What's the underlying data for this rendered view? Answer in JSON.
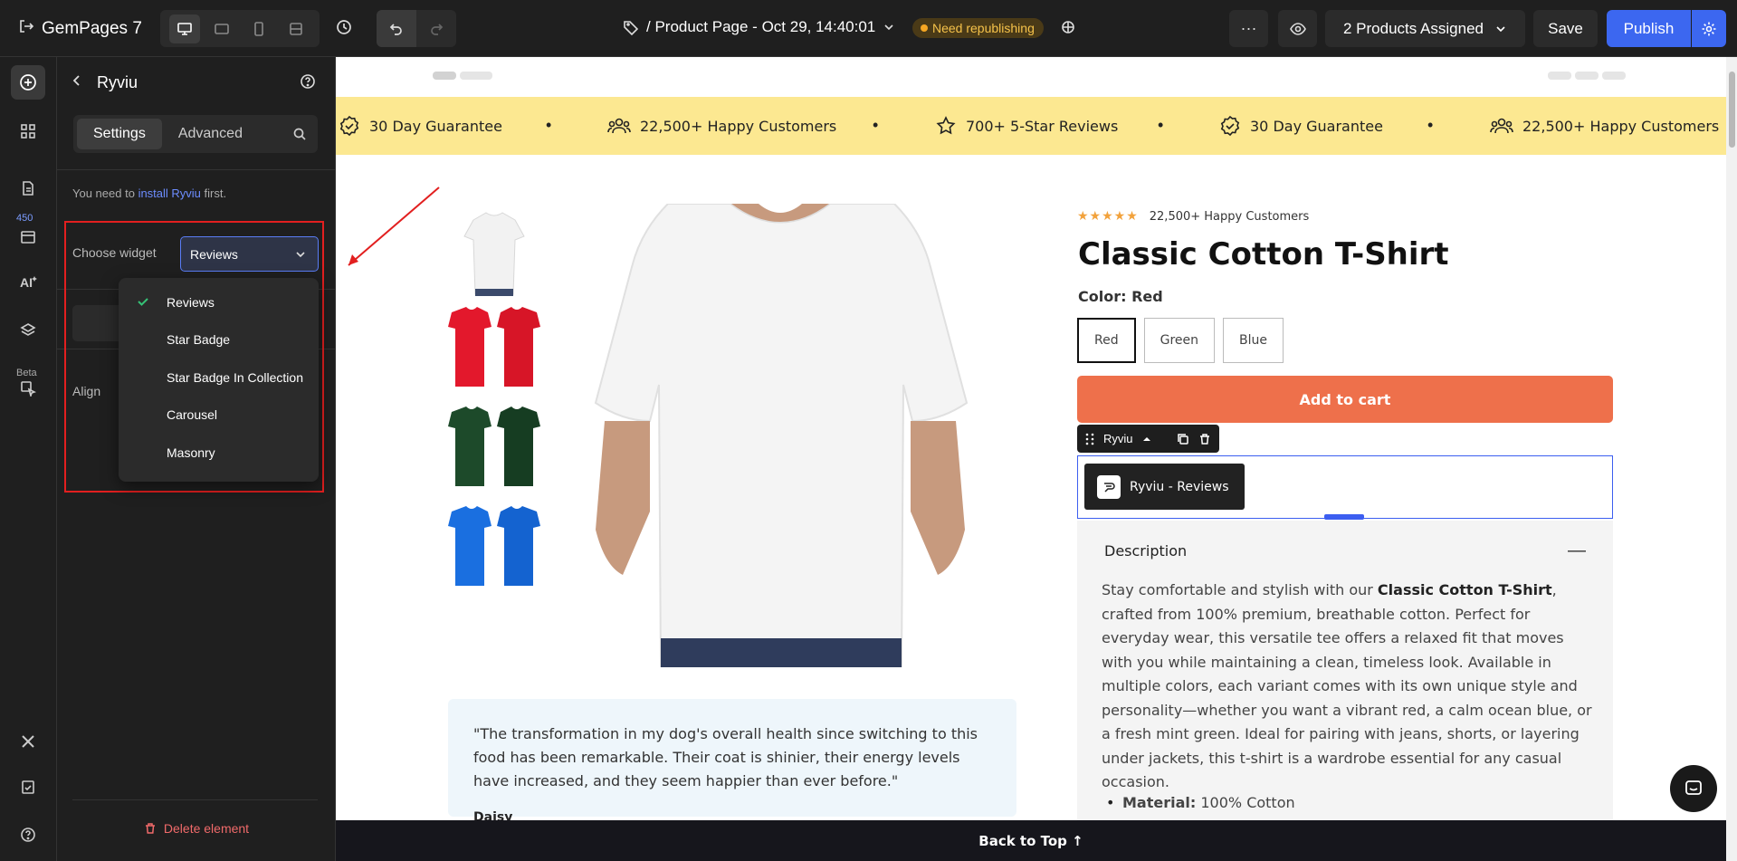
{
  "topbar": {
    "app_name": "GemPages 7",
    "page_title": "/ Product Page - Oct 29, 14:40:01",
    "status_badge": "Need republishing",
    "products_assigned": "2 Products Assigned",
    "save_label": "Save",
    "publish_label": "Publish",
    "more_glyph": "···"
  },
  "rail": {
    "count_badge": "450",
    "beta_label": "Beta"
  },
  "panel": {
    "title": "Ryviu",
    "tabs": [
      {
        "label": "Settings",
        "active": true
      },
      {
        "label": "Advanced",
        "active": false
      }
    ],
    "install_note_prefix": "You need to",
    "install_link": "install Ryviu",
    "install_note_suffix": "first.",
    "choose_widget_label": "Choose widget",
    "selected_widget": "Reviews",
    "align_label": "Align",
    "widget_options": [
      {
        "label": "Reviews",
        "selected": true
      },
      {
        "label": "Star Badge",
        "selected": false
      },
      {
        "label": "Star Badge In Collection",
        "selected": false
      },
      {
        "label": "Carousel",
        "selected": false
      },
      {
        "label": "Masonry",
        "selected": false
      }
    ],
    "delete_label": "Delete element"
  },
  "canvas": {
    "marquee": [
      {
        "icon": "badge-check-icon",
        "text": "30 Day Guarantee"
      },
      {
        "icon": "users-icon",
        "text": "22,500+ Happy Customers"
      },
      {
        "icon": "star-icon",
        "text": "700+ 5-Star Reviews"
      },
      {
        "icon": "badge-check-icon",
        "text": "30 Day Guarantee"
      },
      {
        "icon": "users-icon",
        "text": "22,500+ Happy Customers"
      }
    ],
    "product": {
      "rating_stars": "★★★★★",
      "rating_text": "22,500+ Happy Customers",
      "title": "Classic Cotton T-Shirt",
      "color_label": "Color: Red",
      "colors": [
        {
          "label": "Red",
          "selected": true
        },
        {
          "label": "Green",
          "selected": false
        },
        {
          "label": "Blue",
          "selected": false
        }
      ],
      "add_to_cart": "Add to cart",
      "thumb_colors": [
        "#ffffff",
        "#e3182c",
        "#1d4a2a",
        "#1a6fe0"
      ]
    },
    "ryviu": {
      "toolbar_label": "Ryviu",
      "widget_label": "Ryviu - Reviews"
    },
    "description": {
      "heading": "Description",
      "lead": "Stay comfortable and stylish with our ",
      "lead_bold": "Classic Cotton T-Shirt",
      "body": ", crafted from 100% premium, breathable cotton. Perfect for everyday wear, this versatile tee offers a relaxed fit that moves with you while maintaining a clean, timeless look. Available in multiple colors, each variant comes with its own unique style and personality—whether you want a vibrant red, a calm ocean blue, or a fresh mint green. Ideal for pairing with jeans, shorts, or layering under jackets, this t-shirt is a wardrobe essential for any casual occasion.",
      "bullet_label": "Material:",
      "bullet_value": " 100% Cotton"
    },
    "testimonial": {
      "quote": "\"The transformation in my dog's overall health since switching to this food has been remarkable. Their coat is shinier, their energy levels have increased, and they seem happier than ever before.\"",
      "author": "Daisy"
    },
    "back_to_top": "Back to Top ↑"
  },
  "colors": {
    "accent": "#3c67f0",
    "cta": "#ee704b",
    "marquee_bg": "#fce891",
    "highlight": "#e21f1f"
  }
}
